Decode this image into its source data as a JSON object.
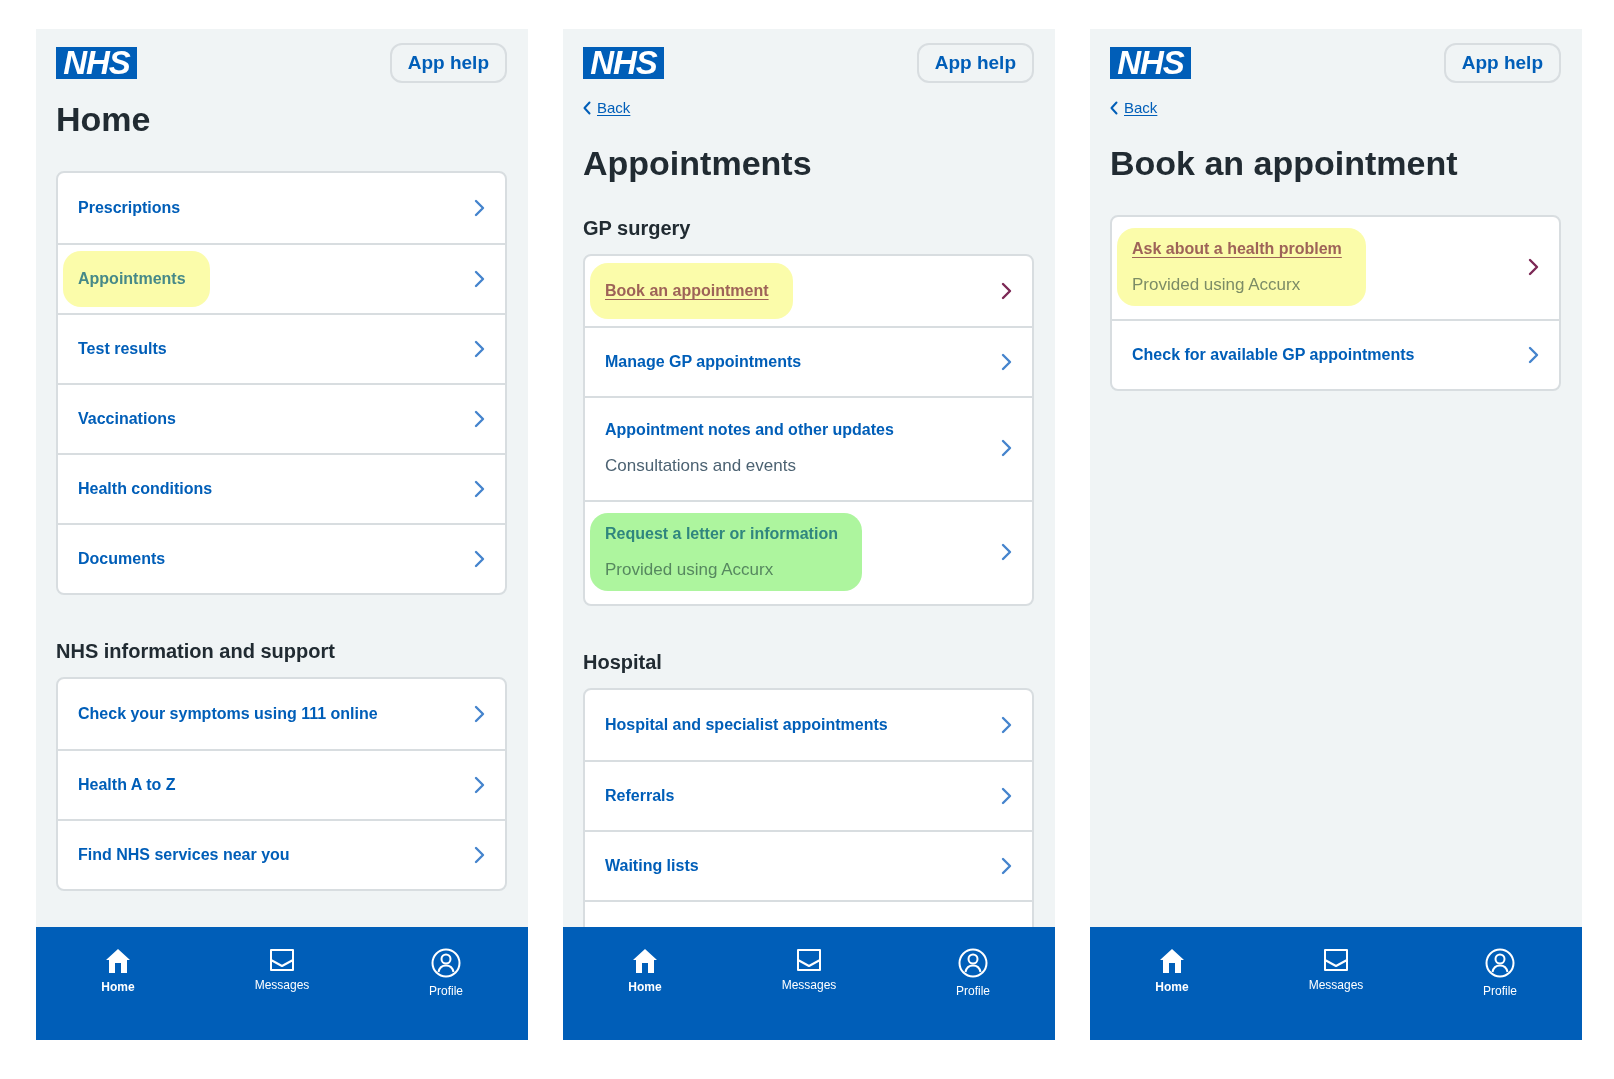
{
  "screens": [
    {
      "logo": "NHS",
      "help_button": "App help",
      "title": "Home",
      "sections": [
        {
          "items": [
            {
              "title": "Prescriptions",
              "visited": false
            },
            {
              "title": "Appointments",
              "visited": false,
              "color": "#fbfcaa"
            },
            {
              "title": "Test results",
              "visited": false
            },
            {
              "title": "Vaccinations",
              "visited": false
            },
            {
              "title": "Health conditions",
              "visited": false
            },
            {
              "title": "Documents",
              "visited": false
            }
          ]
        },
        {
          "heading": "NHS information and support",
          "items": [
            {
              "title": "Check your symptoms using 111 online",
              "visited": false
            },
            {
              "title": "Health A to Z",
              "visited": false
            },
            {
              "title": "Find NHS services near you",
              "visited": false
            }
          ]
        }
      ],
      "nav": [
        {
          "kind": "home",
          "label": "Home",
          "selected": true
        },
        {
          "kind": "messages",
          "label": "Messages",
          "selected": false
        },
        {
          "kind": "profile",
          "label": "Profile",
          "selected": false
        }
      ]
    },
    {
      "logo": "NHS",
      "help_button": "App help",
      "back_link": "Back",
      "title": "Appointments",
      "sections": [
        {
          "heading": "GP surgery",
          "items": [
            {
              "title": "Book an appointment",
              "visited": true,
              "color": "#fbfcaa"
            },
            {
              "title": "Manage GP appointments",
              "visited": false
            },
            {
              "title": "Appointment notes and other updates",
              "description": "Consultations and events",
              "visited": false
            },
            {
              "title": "Request a letter or information",
              "description": "Provided using Accurx",
              "visited": false,
              "color": "#adf59e"
            }
          ]
        },
        {
          "heading": "Hospital",
          "continues_below": true,
          "items": [
            {
              "title": "Hospital and specialist appointments",
              "visited": false
            },
            {
              "title": "Referrals",
              "visited": false
            },
            {
              "title": "Waiting lists",
              "visited": false
            }
          ]
        }
      ],
      "nav": [
        {
          "kind": "home",
          "label": "Home",
          "selected": true
        },
        {
          "kind": "messages",
          "label": "Messages",
          "selected": false
        },
        {
          "kind": "profile",
          "label": "Profile",
          "selected": false
        }
      ]
    },
    {
      "logo": "NHS",
      "help_button": "App help",
      "back_link": "Back",
      "title": "Book an appointment",
      "sections": [
        {
          "items": [
            {
              "title": "Ask about a health problem",
              "description": "Provided using Accurx",
              "visited": true,
              "color": "#fbfcaa"
            },
            {
              "title": "Check for available GP appointments",
              "visited": false
            }
          ]
        }
      ],
      "nav": [
        {
          "kind": "home",
          "label": "Home",
          "selected": true
        },
        {
          "kind": "messages",
          "label": "Messages",
          "selected": false
        },
        {
          "kind": "profile",
          "label": "Profile",
          "selected": false
        }
      ]
    }
  ]
}
